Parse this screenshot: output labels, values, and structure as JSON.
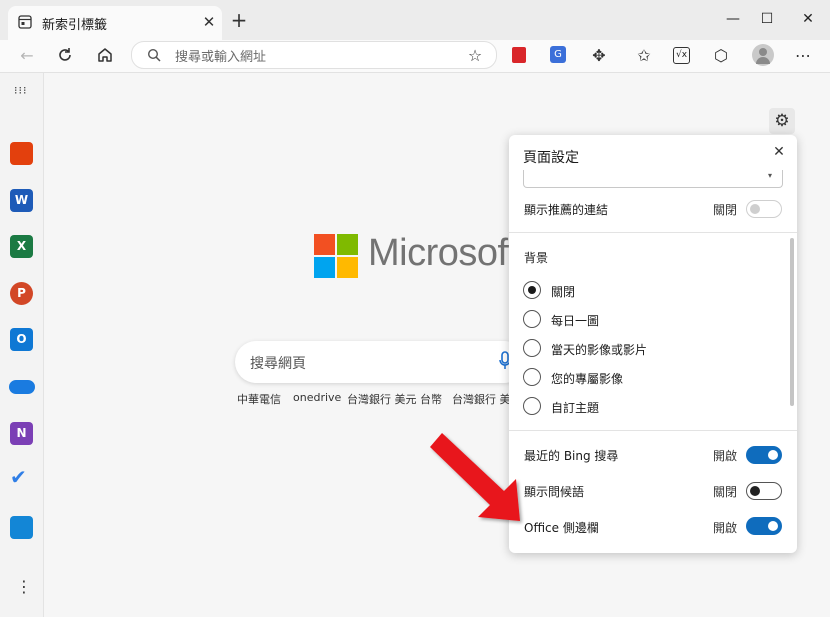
{
  "tab": {
    "title": "新索引標籤"
  },
  "toolbar": {
    "address_placeholder": "搜尋或輸入網址"
  },
  "window_controls": {
    "minimize": "—",
    "maximize": "☐",
    "close": "✕"
  },
  "main": {
    "logo_text": "Microsoft",
    "search_placeholder": "搜尋網頁",
    "quick_links": [
      "中華電信",
      "onedrive",
      "台灣銀行 美元 台幣",
      "台灣銀行 美元"
    ]
  },
  "settings_panel": {
    "title": "頁面設定",
    "dim_row": {
      "label": "顯示推薦的連結",
      "state": "關閉"
    },
    "background_section": {
      "title": "背景",
      "options": [
        "關閉",
        "每日一圖",
        "當天的影像或影片",
        "您的專屬影像",
        "自訂主題"
      ],
      "selected": "關閉"
    },
    "toggles": [
      {
        "label": "最近的 Bing 搜尋",
        "state": "開啟",
        "on": true
      },
      {
        "label": "顯示問候語",
        "state": "關閉",
        "on": false
      },
      {
        "label": "Office 側邊欄",
        "state": "開啟",
        "on": true
      }
    ]
  },
  "colors": {
    "accent": "#0f6cbd",
    "arrow": "#e8141b"
  }
}
